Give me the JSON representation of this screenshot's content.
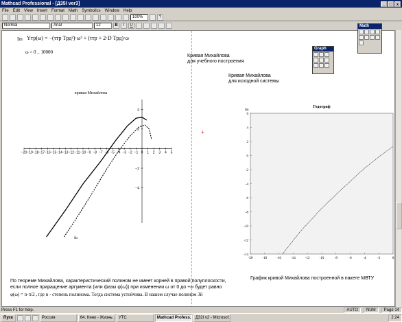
{
  "window": {
    "title": "Mathcad Professional - [Д35I ver3]"
  },
  "menu": [
    "File",
    "Edit",
    "View",
    "Insert",
    "Format",
    "Math",
    "Symbolics",
    "Window",
    "Help"
  ],
  "toolbar": {
    "zoom": "100%"
  },
  "format": {
    "style": "Normal",
    "font": "Arial",
    "size": "12"
  },
  "palettes": {
    "math": "Math",
    "graph": "Graph"
  },
  "doc": {
    "im_label": "Im",
    "formula_left": "Yтр(ω) = −(τтр Tрд²)·ω³ + (τтр + 2·D Tрд)·ω",
    "range_def": "ω = 0 .. 10000",
    "caption1_line1": "Кривая Михайлова",
    "caption1_line2": "для учебного построения",
    "caption2_line1": "Кривая Михайлова",
    "caption2_line2": "для исходной системы",
    "plot_title": "кривая Михайлова",
    "plot_xlabel": "Re",
    "plot_ylabel": "Im",
    "hodo_title": "Годограф",
    "hodo_yaxis_label": "Im",
    "bottom_text_line1": "По теореме Михайлова, характеристический полином не имеет корней в правой полуплоскости,",
    "bottom_text_line2": "если полное приращение аргумента (или фазы φ(ω)) при изменении ω от 0 до +∞ будет равно",
    "bottom_text_line3": "φ(ω) = n·π/2 , где n - степень полинома. Тогда система устойчива. В нашем случае полином 3й",
    "mvtu_caption": "График кривой Михайлова построенной в пакете МВТУ"
  },
  "status": {
    "help": "Press F1 for help.",
    "mode": "AUTO",
    "num": "NUM",
    "page": "Page 14"
  },
  "taskbar": {
    "start": "Пуск",
    "tasks": [
      "Россия",
      "64. Кино - Жизнь ...",
      "УТС",
      "Mathcad Profess...",
      "Д32I v2 - Microsof..."
    ],
    "time": "2:24"
  },
  "chart_data": [
    {
      "type": "line",
      "title": "кривая Михайлова",
      "xlabel": "Re",
      "ylabel": "Im",
      "x_ticks": [
        -20,
        -19,
        -18,
        -17,
        -16,
        -15,
        -14,
        -13,
        -12,
        -11,
        -10,
        -9,
        -8,
        -7,
        -6,
        -5,
        -4,
        -3,
        -2,
        -1,
        0,
        1,
        2,
        3,
        4,
        5
      ],
      "y_ticks": [
        4,
        2,
        -2,
        -4
      ],
      "xlim": [
        -20,
        5
      ],
      "ylim": [
        -9,
        5
      ],
      "series": [
        {
          "style": "solid",
          "x": [
            -16.2,
            -13,
            -10,
            -7,
            -4.5,
            -2.5,
            -1,
            0,
            0.8
          ],
          "y": [
            -9,
            -6.3,
            -3.6,
            -1.3,
            0.8,
            2.3,
            3.1,
            3.2,
            2.9
          ]
        },
        {
          "style": "dashed",
          "x": [
            -13.2,
            -11,
            -8.5,
            -6,
            -3.8,
            -2,
            -0.5,
            0.5,
            1.2,
            1.6
          ],
          "y": [
            -9,
            -7,
            -4.6,
            -2.1,
            -0.1,
            1.3,
            2.2,
            2.4,
            2.0,
            1.0
          ]
        }
      ]
    },
    {
      "type": "line",
      "title": "Годограф",
      "x_ticks": [
        -20,
        -18,
        -16,
        -14,
        -12,
        -10,
        -8,
        -6,
        -4,
        -2,
        0
      ],
      "y_ticks": [
        6,
        4,
        2,
        0,
        -2,
        -4,
        -6,
        -8,
        -10,
        -12,
        -14
      ],
      "xlim": [
        -20,
        0
      ],
      "ylim": [
        -14,
        6
      ],
      "series": [
        {
          "style": "solid",
          "x": [
            -15.5,
            -13,
            -10,
            -7,
            -4,
            -2,
            0
          ],
          "y": [
            -14,
            -10.8,
            -7.5,
            -4.6,
            -1.8,
            -0.2,
            1.3
          ]
        }
      ]
    }
  ]
}
